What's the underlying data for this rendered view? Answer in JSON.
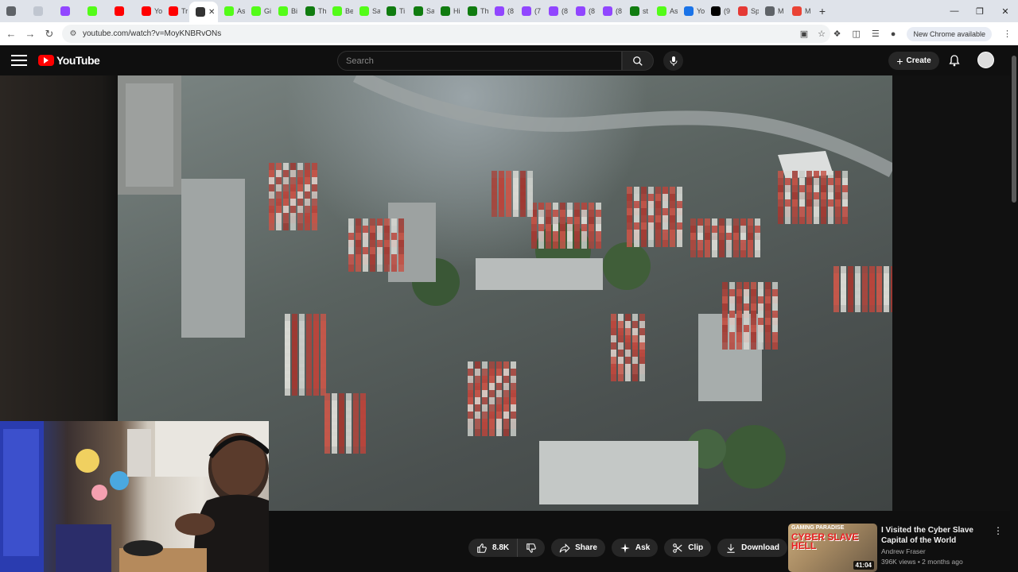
{
  "browser": {
    "tabs": [
      {
        "icon": "chrome-icon",
        "label": "",
        "color": "#5f6368"
      },
      {
        "icon": "blank-icon",
        "label": "",
        "color": "#c0c6d0"
      },
      {
        "icon": "twitch-icon",
        "label": "",
        "color": "#9146ff"
      },
      {
        "icon": "kick-icon",
        "label": "",
        "color": "#53fc18"
      },
      {
        "icon": "youtube-icon",
        "label": "",
        "color": "#ff0000"
      },
      {
        "icon": "youtube-icon",
        "label": "Yo",
        "color": "#ff0000"
      },
      {
        "icon": "youtube-icon",
        "label": "Tr",
        "color": "#ff0000"
      },
      {
        "icon": "volume-icon",
        "label": "",
        "color": "#333333"
      },
      {
        "icon": "kick-icon",
        "label": "As",
        "color": "#53fc18"
      },
      {
        "icon": "kick-icon",
        "label": "Gi",
        "color": "#53fc18"
      },
      {
        "icon": "kick-icon",
        "label": "Bi",
        "color": "#53fc18"
      },
      {
        "icon": "xbox-icon",
        "label": "Th",
        "color": "#107c10"
      },
      {
        "icon": "kick-icon",
        "label": "Be",
        "color": "#53fc18"
      },
      {
        "icon": "kick-icon",
        "label": "Sa",
        "color": "#53fc18"
      },
      {
        "icon": "xbox-icon",
        "label": "Ti",
        "color": "#107c10"
      },
      {
        "icon": "xbox-icon",
        "label": "Sa",
        "color": "#107c10"
      },
      {
        "icon": "xbox-icon",
        "label": "Hi",
        "color": "#107c10"
      },
      {
        "icon": "xbox-icon",
        "label": "Th",
        "color": "#107c10"
      },
      {
        "icon": "twitch-icon",
        "label": "(8",
        "color": "#9146ff"
      },
      {
        "icon": "twitch-icon",
        "label": "(7",
        "color": "#9146ff"
      },
      {
        "icon": "twitch-icon",
        "label": "(8",
        "color": "#9146ff"
      },
      {
        "icon": "twitch-icon",
        "label": "(8",
        "color": "#9146ff"
      },
      {
        "icon": "twitch-icon",
        "label": "(8",
        "color": "#9146ff"
      },
      {
        "icon": "xbox-icon",
        "label": "st",
        "color": "#107c10"
      },
      {
        "icon": "kick-icon",
        "label": "As",
        "color": "#53fc18"
      },
      {
        "icon": "globe-icon",
        "label": "Yo",
        "color": "#1a73e8"
      },
      {
        "icon": "threads-icon",
        "label": "(9",
        "color": "#000000"
      },
      {
        "icon": "red-icon",
        "label": "Sp",
        "color": "#e53935"
      },
      {
        "icon": "chrome-icon",
        "label": "M",
        "color": "#5f6368"
      },
      {
        "icon": "gmail-icon",
        "label": "M",
        "color": "#ea4335"
      }
    ],
    "active_tab_index": 7,
    "url": "youtube.com/watch?v=MoyKNBRvONs",
    "new_chrome_label": "New Chrome available"
  },
  "youtube": {
    "logo_text": "YouTube",
    "search_placeholder": "Search",
    "create_label": "Create",
    "actions": {
      "like_count": "8.8K",
      "share_label": "Share",
      "ask_label": "Ask",
      "clip_label": "Clip",
      "download_label": "Download"
    },
    "recommendation": {
      "title": "I Visited the Cyber Slave Capital of the World",
      "channel": "Andrew Fraser",
      "meta": "396K views • 2 months ago",
      "duration": "41:04",
      "thumb_line1": "GAMING PARADISE",
      "thumb_line2": "CYBER SLAVE HELL"
    }
  }
}
